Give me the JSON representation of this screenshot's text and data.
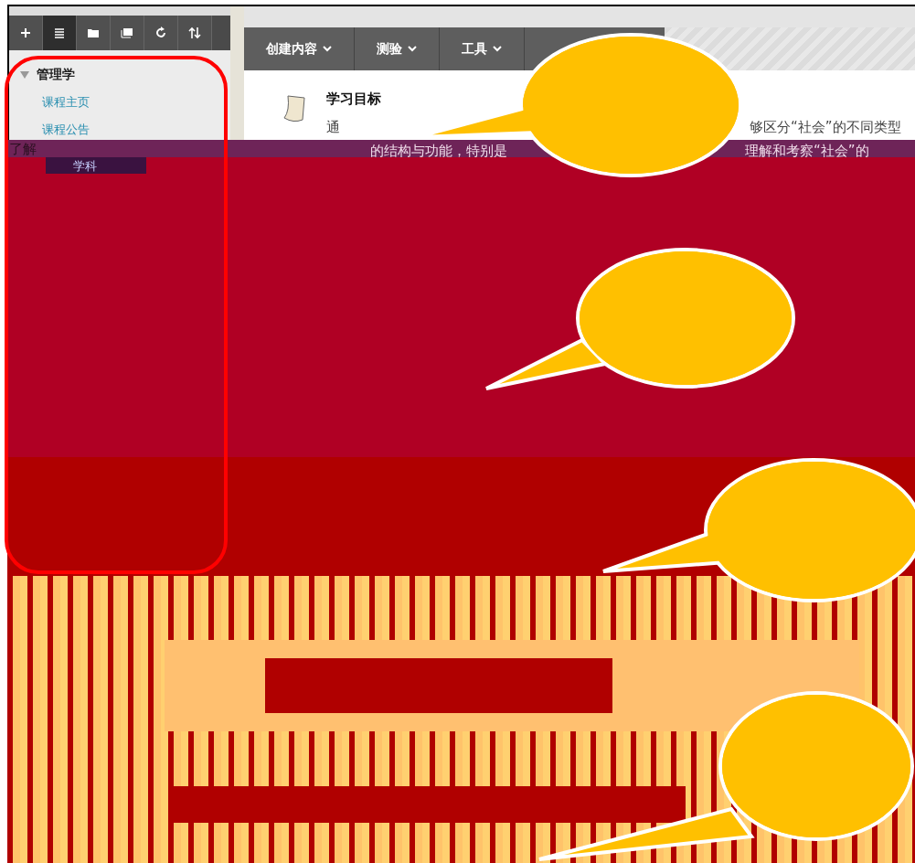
{
  "toolbar": {
    "buttons": [
      {
        "kind": "add",
        "selected": false
      },
      {
        "kind": "list",
        "selected": true
      },
      {
        "kind": "folder",
        "selected": false
      },
      {
        "kind": "window",
        "selected": false
      },
      {
        "kind": "refresh",
        "selected": false
      },
      {
        "kind": "sort",
        "selected": false
      }
    ]
  },
  "sidebar": {
    "title": "管理学",
    "expanded": true,
    "items": [
      "课程主页",
      "课程公告"
    ]
  },
  "menu": [
    "创建内容",
    "测验",
    "工具"
  ],
  "content": {
    "title": "学习目标",
    "line_1": [
      "通",
      "够区分“社会”的不同类型"
    ],
    "line_2": [
      "了解",
      "的结构与功能，特别是",
      "理解和考察“社会”的"
    ],
    "sub_label": "学科"
  }
}
